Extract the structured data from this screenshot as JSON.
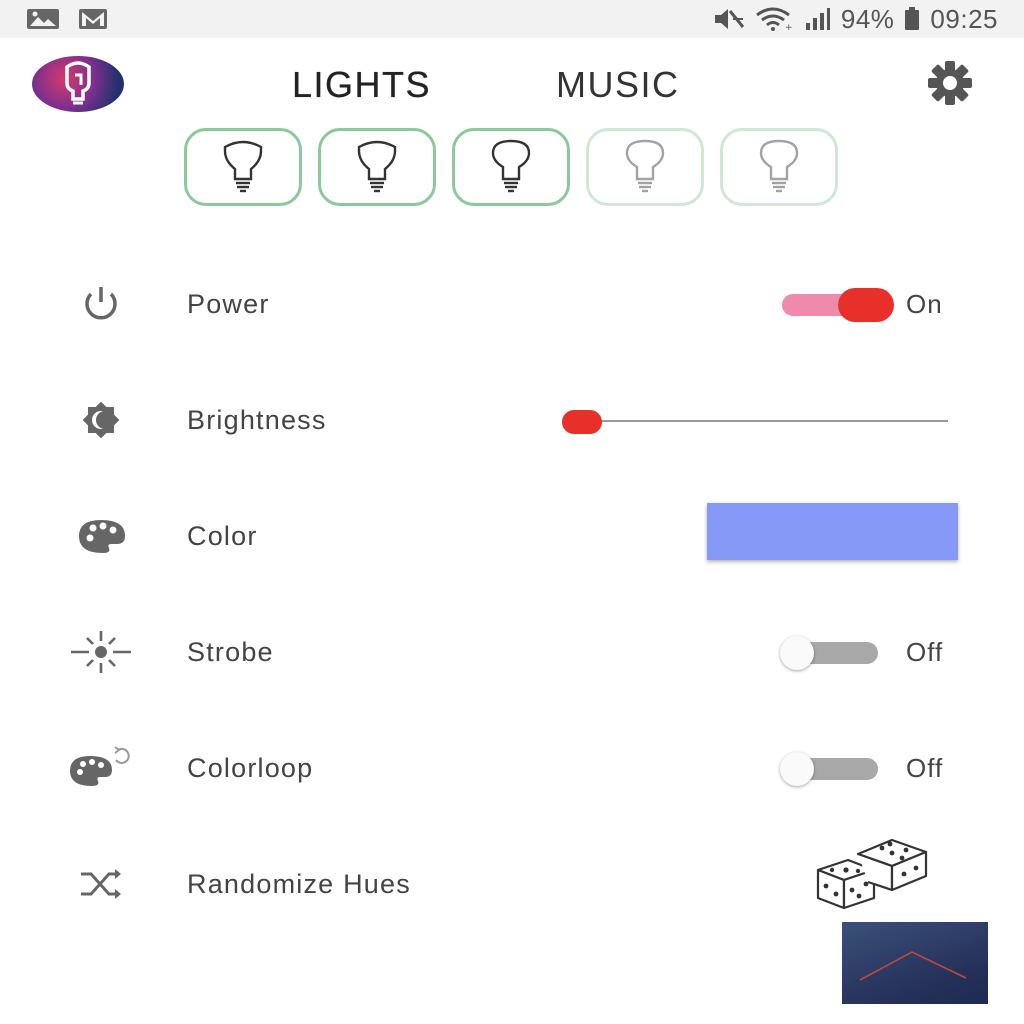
{
  "status_bar": {
    "battery_percent": "94%",
    "time": "09:25",
    "icons": [
      "gallery-icon",
      "gmail-icon",
      "mute-icon",
      "wifi-icon",
      "signal-icon",
      "battery-icon"
    ]
  },
  "header": {
    "tabs": [
      {
        "label": "LIGHTS",
        "active": true
      },
      {
        "label": "MUSIC",
        "active": false
      }
    ],
    "logo_icon": "app-logo-bulb-icon",
    "settings_icon": "gear-icon"
  },
  "bulbs": [
    {
      "icon": "bulb-icon",
      "selected": true,
      "color": "#8cc99a"
    },
    {
      "icon": "bulb-icon",
      "selected": true,
      "color": "#8cc99a"
    },
    {
      "icon": "bulb-icon",
      "selected": true,
      "color": "#8cc99a"
    },
    {
      "icon": "bulb-icon",
      "selected": false,
      "color": "#cde8d3"
    },
    {
      "icon": "bulb-icon",
      "selected": false,
      "color": "#cde8d3"
    }
  ],
  "controls": {
    "power": {
      "label": "Power",
      "icon": "power-icon",
      "state": "On",
      "on": true
    },
    "brightness": {
      "label": "Brightness",
      "icon": "brightness-icon",
      "value": 0.0
    },
    "color": {
      "label": "Color",
      "icon": "palette-icon",
      "value": "#8799f7"
    },
    "strobe": {
      "label": "Strobe",
      "icon": "strobe-icon",
      "state": "Off",
      "on": false
    },
    "colorloop": {
      "label": "Colorloop",
      "icon": "palette-loop-icon",
      "state": "Off",
      "on": false
    },
    "randomize": {
      "label": "Randomize Hues",
      "icon": "shuffle-icon",
      "action_icon": "dice-icon"
    }
  },
  "colors": {
    "accent": "#e8302a",
    "accent_track": "#f08aac",
    "bulb_border": "#8cc99a"
  },
  "fab": {
    "icon": "chevron-up-icon"
  }
}
